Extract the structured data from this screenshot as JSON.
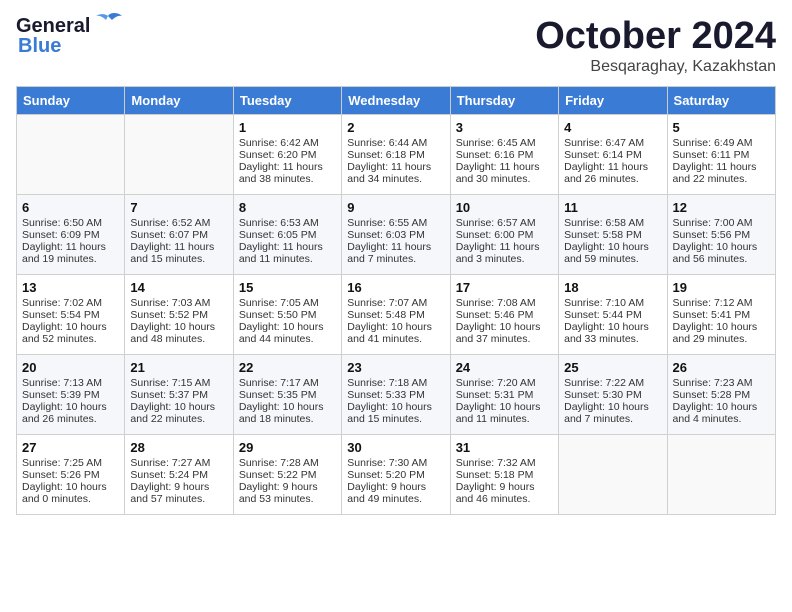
{
  "header": {
    "logo_general": "General",
    "logo_blue": "Blue",
    "month_title": "October 2024",
    "subtitle": "Besqaraghay, Kazakhstan"
  },
  "columns": [
    "Sunday",
    "Monday",
    "Tuesday",
    "Wednesday",
    "Thursday",
    "Friday",
    "Saturday"
  ],
  "weeks": [
    [
      {
        "day": "",
        "sunrise": "",
        "sunset": "",
        "daylight": ""
      },
      {
        "day": "",
        "sunrise": "",
        "sunset": "",
        "daylight": ""
      },
      {
        "day": "1",
        "sunrise": "Sunrise: 6:42 AM",
        "sunset": "Sunset: 6:20 PM",
        "daylight": "Daylight: 11 hours and 38 minutes."
      },
      {
        "day": "2",
        "sunrise": "Sunrise: 6:44 AM",
        "sunset": "Sunset: 6:18 PM",
        "daylight": "Daylight: 11 hours and 34 minutes."
      },
      {
        "day": "3",
        "sunrise": "Sunrise: 6:45 AM",
        "sunset": "Sunset: 6:16 PM",
        "daylight": "Daylight: 11 hours and 30 minutes."
      },
      {
        "day": "4",
        "sunrise": "Sunrise: 6:47 AM",
        "sunset": "Sunset: 6:14 PM",
        "daylight": "Daylight: 11 hours and 26 minutes."
      },
      {
        "day": "5",
        "sunrise": "Sunrise: 6:49 AM",
        "sunset": "Sunset: 6:11 PM",
        "daylight": "Daylight: 11 hours and 22 minutes."
      }
    ],
    [
      {
        "day": "6",
        "sunrise": "Sunrise: 6:50 AM",
        "sunset": "Sunset: 6:09 PM",
        "daylight": "Daylight: 11 hours and 19 minutes."
      },
      {
        "day": "7",
        "sunrise": "Sunrise: 6:52 AM",
        "sunset": "Sunset: 6:07 PM",
        "daylight": "Daylight: 11 hours and 15 minutes."
      },
      {
        "day": "8",
        "sunrise": "Sunrise: 6:53 AM",
        "sunset": "Sunset: 6:05 PM",
        "daylight": "Daylight: 11 hours and 11 minutes."
      },
      {
        "day": "9",
        "sunrise": "Sunrise: 6:55 AM",
        "sunset": "Sunset: 6:03 PM",
        "daylight": "Daylight: 11 hours and 7 minutes."
      },
      {
        "day": "10",
        "sunrise": "Sunrise: 6:57 AM",
        "sunset": "Sunset: 6:00 PM",
        "daylight": "Daylight: 11 hours and 3 minutes."
      },
      {
        "day": "11",
        "sunrise": "Sunrise: 6:58 AM",
        "sunset": "Sunset: 5:58 PM",
        "daylight": "Daylight: 10 hours and 59 minutes."
      },
      {
        "day": "12",
        "sunrise": "Sunrise: 7:00 AM",
        "sunset": "Sunset: 5:56 PM",
        "daylight": "Daylight: 10 hours and 56 minutes."
      }
    ],
    [
      {
        "day": "13",
        "sunrise": "Sunrise: 7:02 AM",
        "sunset": "Sunset: 5:54 PM",
        "daylight": "Daylight: 10 hours and 52 minutes."
      },
      {
        "day": "14",
        "sunrise": "Sunrise: 7:03 AM",
        "sunset": "Sunset: 5:52 PM",
        "daylight": "Daylight: 10 hours and 48 minutes."
      },
      {
        "day": "15",
        "sunrise": "Sunrise: 7:05 AM",
        "sunset": "Sunset: 5:50 PM",
        "daylight": "Daylight: 10 hours and 44 minutes."
      },
      {
        "day": "16",
        "sunrise": "Sunrise: 7:07 AM",
        "sunset": "Sunset: 5:48 PM",
        "daylight": "Daylight: 10 hours and 41 minutes."
      },
      {
        "day": "17",
        "sunrise": "Sunrise: 7:08 AM",
        "sunset": "Sunset: 5:46 PM",
        "daylight": "Daylight: 10 hours and 37 minutes."
      },
      {
        "day": "18",
        "sunrise": "Sunrise: 7:10 AM",
        "sunset": "Sunset: 5:44 PM",
        "daylight": "Daylight: 10 hours and 33 minutes."
      },
      {
        "day": "19",
        "sunrise": "Sunrise: 7:12 AM",
        "sunset": "Sunset: 5:41 PM",
        "daylight": "Daylight: 10 hours and 29 minutes."
      }
    ],
    [
      {
        "day": "20",
        "sunrise": "Sunrise: 7:13 AM",
        "sunset": "Sunset: 5:39 PM",
        "daylight": "Daylight: 10 hours and 26 minutes."
      },
      {
        "day": "21",
        "sunrise": "Sunrise: 7:15 AM",
        "sunset": "Sunset: 5:37 PM",
        "daylight": "Daylight: 10 hours and 22 minutes."
      },
      {
        "day": "22",
        "sunrise": "Sunrise: 7:17 AM",
        "sunset": "Sunset: 5:35 PM",
        "daylight": "Daylight: 10 hours and 18 minutes."
      },
      {
        "day": "23",
        "sunrise": "Sunrise: 7:18 AM",
        "sunset": "Sunset: 5:33 PM",
        "daylight": "Daylight: 10 hours and 15 minutes."
      },
      {
        "day": "24",
        "sunrise": "Sunrise: 7:20 AM",
        "sunset": "Sunset: 5:31 PM",
        "daylight": "Daylight: 10 hours and 11 minutes."
      },
      {
        "day": "25",
        "sunrise": "Sunrise: 7:22 AM",
        "sunset": "Sunset: 5:30 PM",
        "daylight": "Daylight: 10 hours and 7 minutes."
      },
      {
        "day": "26",
        "sunrise": "Sunrise: 7:23 AM",
        "sunset": "Sunset: 5:28 PM",
        "daylight": "Daylight: 10 hours and 4 minutes."
      }
    ],
    [
      {
        "day": "27",
        "sunrise": "Sunrise: 7:25 AM",
        "sunset": "Sunset: 5:26 PM",
        "daylight": "Daylight: 10 hours and 0 minutes."
      },
      {
        "day": "28",
        "sunrise": "Sunrise: 7:27 AM",
        "sunset": "Sunset: 5:24 PM",
        "daylight": "Daylight: 9 hours and 57 minutes."
      },
      {
        "day": "29",
        "sunrise": "Sunrise: 7:28 AM",
        "sunset": "Sunset: 5:22 PM",
        "daylight": "Daylight: 9 hours and 53 minutes."
      },
      {
        "day": "30",
        "sunrise": "Sunrise: 7:30 AM",
        "sunset": "Sunset: 5:20 PM",
        "daylight": "Daylight: 9 hours and 49 minutes."
      },
      {
        "day": "31",
        "sunrise": "Sunrise: 7:32 AM",
        "sunset": "Sunset: 5:18 PM",
        "daylight": "Daylight: 9 hours and 46 minutes."
      },
      {
        "day": "",
        "sunrise": "",
        "sunset": "",
        "daylight": ""
      },
      {
        "day": "",
        "sunrise": "",
        "sunset": "",
        "daylight": ""
      }
    ]
  ]
}
